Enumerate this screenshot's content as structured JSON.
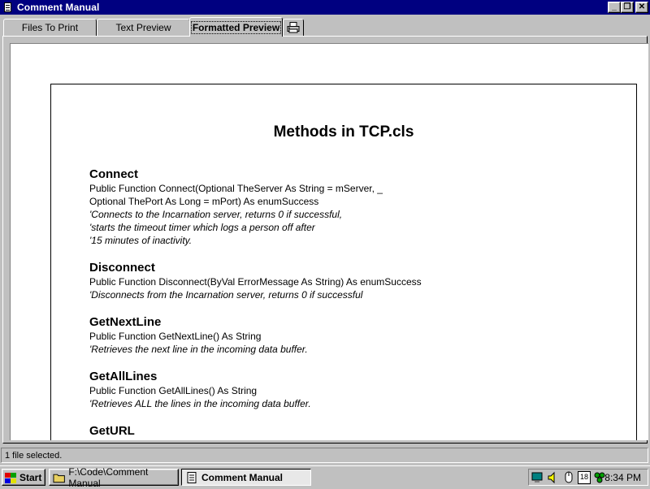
{
  "window": {
    "title": "Comment Manual",
    "controls": {
      "minimize": "_",
      "maximize": "❐",
      "close": "✕"
    }
  },
  "tabs": [
    {
      "label": "Files To Print",
      "active": false
    },
    {
      "label": "Text Preview",
      "active": false
    },
    {
      "label": "Formatted Preview",
      "active": true
    }
  ],
  "preview": {
    "title": "Methods in TCP.cls",
    "methods": [
      {
        "name": "Connect",
        "signature": [
          "Public Function Connect(Optional TheServer As String = mServer, _",
          "Optional ThePort As Long = mPort) As enumSuccess"
        ],
        "comments": [
          "'Connects to the Incarnation server, returns 0 if successful,",
          "'starts the timeout timer which logs a person off after",
          "'15 minutes of inactivity."
        ]
      },
      {
        "name": "Disconnect",
        "signature": [
          "Public Function Disconnect(ByVal ErrorMessage As String) As enumSuccess"
        ],
        "comments": [
          "'Disconnects from the Incarnation server, returns 0 if successful"
        ]
      },
      {
        "name": "GetNextLine",
        "signature": [
          "Public Function GetNextLine() As String"
        ],
        "comments": [
          "'Retrieves the next line in the incoming data buffer."
        ]
      },
      {
        "name": "GetAllLines",
        "signature": [
          "Public Function GetAllLines() As String"
        ],
        "comments": [
          "'Retrieves ALL the lines in the incoming data buffer."
        ]
      },
      {
        "name": "GetURL",
        "signature": [],
        "comments": []
      }
    ]
  },
  "status": {
    "text": "1 file selected."
  },
  "taskbar": {
    "start_label": "Start",
    "tasks": [
      {
        "label": "F:\\Code\\Comment Manual",
        "pressed": false
      },
      {
        "label": "Comment Manual",
        "pressed": true
      }
    ],
    "clock": "8:34 PM",
    "calendar_day": "18"
  },
  "colors": {
    "titlebar": "#000080",
    "face": "#c0c0c0",
    "paper": "#ffffff"
  }
}
